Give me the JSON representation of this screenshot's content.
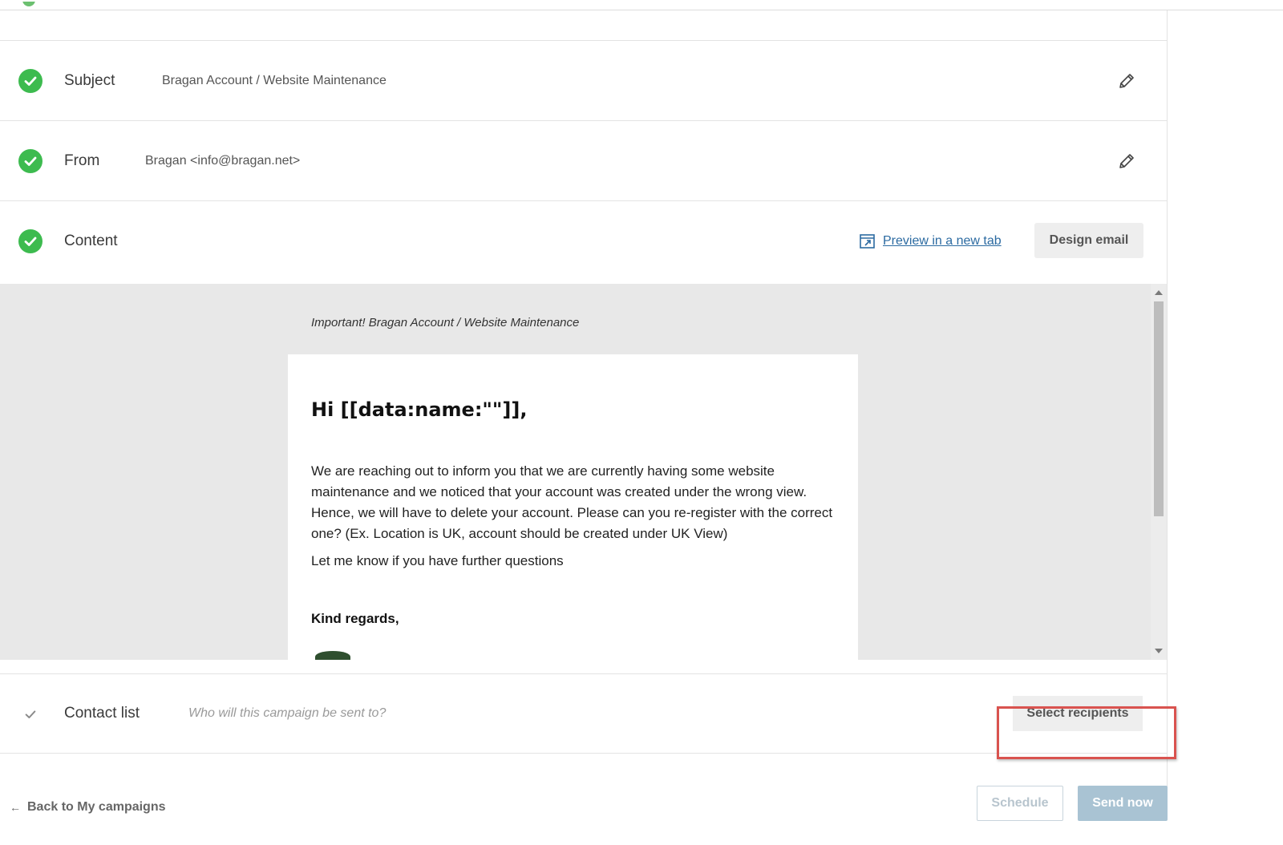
{
  "rows": {
    "subject": {
      "label": "Subject",
      "value": "Bragan Account / Website Maintenance"
    },
    "from": {
      "label": "From",
      "value": "Bragan <info@bragan.net>"
    },
    "content": {
      "label": "Content",
      "preview_link": "Preview in a new tab",
      "design_button": "Design email"
    }
  },
  "email_preview": {
    "subject_line": "Important! Bragan Account / Website Maintenance",
    "greeting": "Hi [[data:name:\"\"]],",
    "body": "We are reaching out to inform you that we are currently having some website maintenance and we noticed that your account was created under the wrong view. Hence, we will have to delete your account. Please can you re-register with the correct one? (Ex. Location is UK, account should be created under UK View)",
    "line2": "Let me know if you have further questions",
    "closing": "Kind regards,"
  },
  "contact_list": {
    "label": "Contact list",
    "placeholder": "Who will this campaign be sent to?",
    "select_button": "Select recipients"
  },
  "footer": {
    "back_link": "Back to My campaigns",
    "schedule_button": "Schedule",
    "send_button": "Send now"
  },
  "colors": {
    "success": "#3dbb4f",
    "link": "#2b6aa1",
    "highlight": "#d9534f",
    "send_disabled": "#a9c3d3"
  },
  "icons": {
    "check": "check-circle-icon",
    "edit": "pencil-icon",
    "preview": "external-preview-icon",
    "back": "arrow-left-icon"
  }
}
